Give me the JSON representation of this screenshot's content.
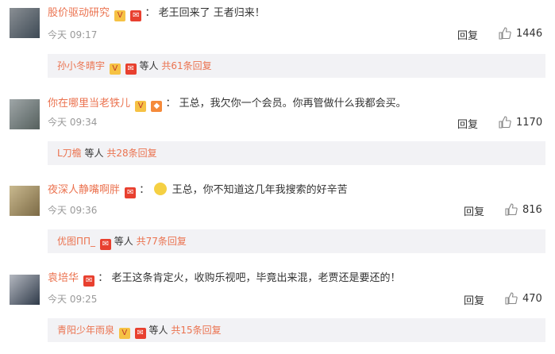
{
  "comments": [
    {
      "user": "股价驱动研究",
      "content": "老王回来了  王者归来！",
      "time": "今天 09:17",
      "reply_label": "回复",
      "likes": "1446",
      "sub_names": "孙小冬晴宇",
      "sub_mid": "等人",
      "sub_more": "共61条回复"
    },
    {
      "user": "你在哪里当老铁儿",
      "content": "王总，我欠你一个会员。你再管做什么我都会买。",
      "time": "今天 09:34",
      "reply_label": "回复",
      "likes": "1170",
      "sub_names": "L刀檐",
      "sub_mid": "等人",
      "sub_more": "共28条回复"
    },
    {
      "user": "夜深人静嘴啊胖",
      "content": "王总，你不知道这几年我搜索的好辛苦",
      "time": "今天 09:36",
      "reply_label": "回复",
      "likes": "816",
      "sub_names": "优图ΠΠ_",
      "sub_mid": "等人",
      "sub_more": "共77条回复"
    },
    {
      "user": "袁培华",
      "content": "老王这条肯定火，收购乐视吧，毕竟出来混，老贾还是要还的！",
      "time": "今天 09:25",
      "reply_label": "回复",
      "likes": "470",
      "sub_names": "青阳少年雨泉",
      "sub_mid": "等人",
      "sub_more": "共15条回复"
    }
  ],
  "colors": {
    "username": "#eb7350",
    "time": "#999999",
    "subbar_bg": "#f2f2f5"
  },
  "icons": {
    "like": "thumbs-up-icon",
    "vip": "vip-badge-icon",
    "redpacket": "red-envelope-icon"
  }
}
